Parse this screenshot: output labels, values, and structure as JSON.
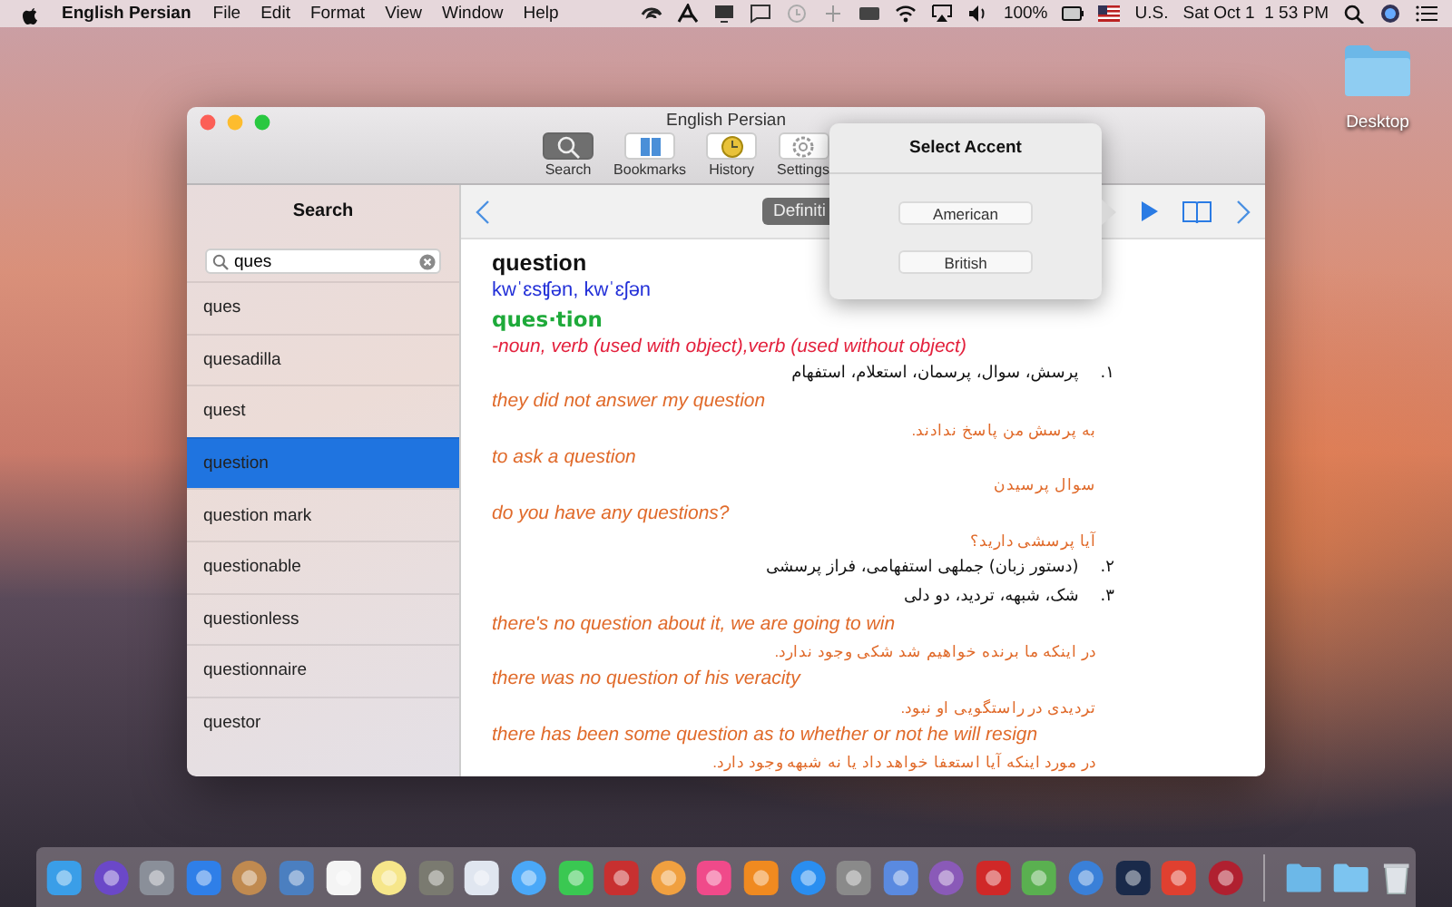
{
  "menubar": {
    "app_name": "English Persian",
    "menus": [
      "File",
      "Edit",
      "Format",
      "View",
      "Window",
      "Help"
    ],
    "battery": "100%",
    "input_source": "U.S.",
    "clock": "Sat Oct 1  1 53 PM"
  },
  "desktop_icon": {
    "label": "Desktop"
  },
  "window": {
    "title": "English Persian",
    "toolbar": [
      {
        "kind": "search",
        "label": "Search",
        "selected": true
      },
      {
        "kind": "bookmarks",
        "label": "Bookmarks",
        "selected": false
      },
      {
        "kind": "history",
        "label": "History",
        "selected": false
      },
      {
        "kind": "settings",
        "label": "Settings",
        "selected": false
      }
    ],
    "sidebar": {
      "title": "Search",
      "search": {
        "value": "ques"
      },
      "items": [
        {
          "label": "ques",
          "selected": false
        },
        {
          "label": "quesadilla",
          "selected": false
        },
        {
          "label": "quest",
          "selected": false
        },
        {
          "label": "question",
          "selected": true
        },
        {
          "label": "question mark",
          "selected": false
        },
        {
          "label": "questionable",
          "selected": false
        },
        {
          "label": "questionless",
          "selected": false
        },
        {
          "label": "questionnaire",
          "selected": false
        },
        {
          "label": "questor",
          "selected": false
        }
      ]
    },
    "content": {
      "tab": "Definiti",
      "headword": "question",
      "pronunciation": "kwˈɛsʧən, kwˈɛʃən",
      "syllables": "ques·tion",
      "part_of_speech": "-noun, verb (used with object),verb (used without object)",
      "senses": [
        {
          "number": "۱.",
          "text": "پرسش، سوال، پرسمان، استعلام، استفهام",
          "examples": [
            {
              "en": "they did not answer my question",
              "fa": "به پرسش من پاسخ ندادند."
            },
            {
              "en": "to ask a question",
              "fa": "سوال پرسیدن"
            },
            {
              "en": "do you have any questions?",
              "fa": "آیا پرسشی دارید؟"
            }
          ]
        },
        {
          "number": "۲.",
          "text": "(دستور زبان) جملهی استفهامی، فراز پرسشی"
        },
        {
          "number": "۳.",
          "text": "شک، شبهه، تردید، دو دلی",
          "examples": [
            {
              "en": "there's no question about it, we are going to win",
              "fa": "در اینکه ما برنده خواهیم شد شکی وجود ندارد."
            },
            {
              "en": "there was no question of his veracity",
              "fa": "تردیدی در راستگویی او نبود."
            },
            {
              "en": "there has been some question as to whether or not he will resign",
              "fa": "در مورد اینکه آیا استعفا خواهد داد یا نه شبهه وجود دارد."
            }
          ]
        }
      ]
    }
  },
  "popover": {
    "title": "Select Accent",
    "buttons": [
      "American",
      "British"
    ]
  }
}
